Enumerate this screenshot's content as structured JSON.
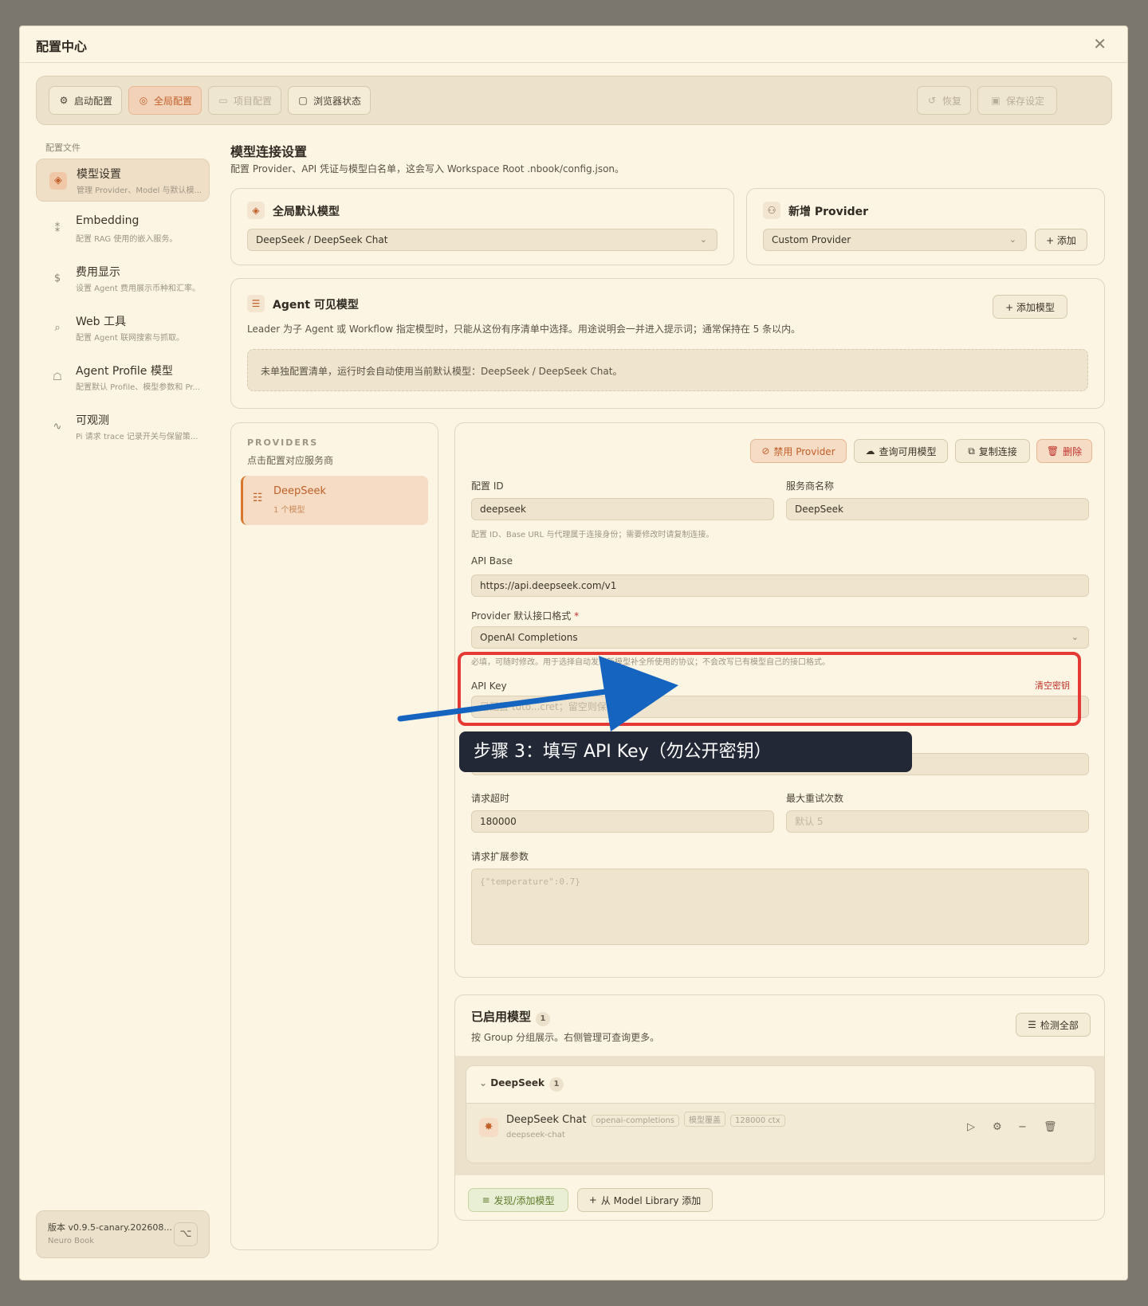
{
  "window": {
    "title": "配置中心"
  },
  "toolbar": {
    "tabs": [
      {
        "label": "启动配置",
        "icon": "gear-icon"
      },
      {
        "label": "全局配置",
        "icon": "globe-icon"
      },
      {
        "label": "项目配置",
        "icon": "folder-icon"
      },
      {
        "label": "浏览器状态",
        "icon": "monitor-icon"
      }
    ],
    "restore_label": "恢复",
    "save_label": "保存设定"
  },
  "sidebar": {
    "section_label": "配置文件",
    "items": [
      {
        "title": "模型设置",
        "sub": "管理 Provider、Model 与默认模..."
      },
      {
        "title": "Embedding",
        "sub": "配置 RAG 使用的嵌入服务。"
      },
      {
        "title": "费用显示",
        "sub": "设置 Agent 费用展示币种和汇率。"
      },
      {
        "title": "Web 工具",
        "sub": "配置 Agent 联网搜索与抓取。"
      },
      {
        "title": "Agent Profile 模型",
        "sub": "配置默认 Profile、模型参数和 Pr..."
      },
      {
        "title": "可观测",
        "sub": "Pi 请求 trace 记录开关与保留策..."
      }
    ],
    "version": "版本 v0.9.5-canary.202608...",
    "product": "Neuro Book"
  },
  "header": {
    "title": "模型连接设置",
    "subtitle": "配置 Provider、API 凭证与模型白名单，这会写入 Workspace Root .nbook/config.json。"
  },
  "default_model": {
    "title": "全局默认模型",
    "value": "DeepSeek / DeepSeek Chat"
  },
  "new_provider": {
    "title": "新增 Provider",
    "value": "Custom Provider",
    "add_label": "+ 添加"
  },
  "agent_models": {
    "title": "Agent 可见模型",
    "add_label": "+ 添加模型",
    "desc": "Leader 为子 Agent 或 Workflow 指定模型时，只能从这份有序清单中选择。用途说明会一并进入提示词；通常保持在 5 条以内。",
    "notice": "未单独配置清单，运行时会自动使用当前默认模型：DeepSeek / DeepSeek Chat。"
  },
  "providers": {
    "heading": "PROVIDERS",
    "sub": "点击配置对应服务商",
    "items": [
      {
        "name": "DeepSeek",
        "count": "1 个模型"
      }
    ]
  },
  "provider_form": {
    "actions": {
      "disable": "禁用 Provider",
      "query": "查询可用模型",
      "copy": "复制连接",
      "delete": "删除"
    },
    "config_id_label": "配置 ID",
    "config_id": "deepseek",
    "name_label": "服务商名称",
    "name": "DeepSeek",
    "id_hint": "配置 ID、Base URL 与代理属于连接身份；需要修改时请复制连接。",
    "api_base_label": "API Base",
    "api_base": "https://api.deepseek.com/v1",
    "format_label": "Provider 默认接口格式",
    "format_required": "*",
    "format_value": "OpenAI Completions",
    "format_hint": "必填，可随时修改。用于选择自动发现新模型补全所使用的协议；不会改写已有模型自己的接口格式。",
    "api_key_label": "API Key",
    "clear_key": "清空密钥",
    "api_key_placeholder": "已配置 tuto...cret；留空则保留",
    "proxy_placeholder": "http://127.0.0.1:7890",
    "timeout_label": "请求超时",
    "timeout": "180000",
    "retry_label": "最大重试次数",
    "retry_placeholder": "默认 5",
    "ext_label": "请求扩展参数",
    "ext_placeholder": "{\"temperature\":0.7}"
  },
  "enabled_models": {
    "title": "已启用模型",
    "count": "1",
    "sub": "按 Group 分组展示。右侧管理可查询更多。",
    "check_all": "检测全部",
    "groups": [
      {
        "name": "DeepSeek",
        "count": "1",
        "models": [
          {
            "name": "DeepSeek Chat",
            "id": "deepseek-chat",
            "tags": [
              "openai-completions",
              "模型覆盖",
              "128000 ctx"
            ]
          }
        ]
      }
    ],
    "discover_label": "发现/添加模型",
    "library_label": "从 Model Library 添加"
  },
  "annotation": {
    "text": "步骤 3：填写 API Key（勿公开密钥）",
    "box_color": "#e53935",
    "arrow_color": "#1565c0"
  }
}
